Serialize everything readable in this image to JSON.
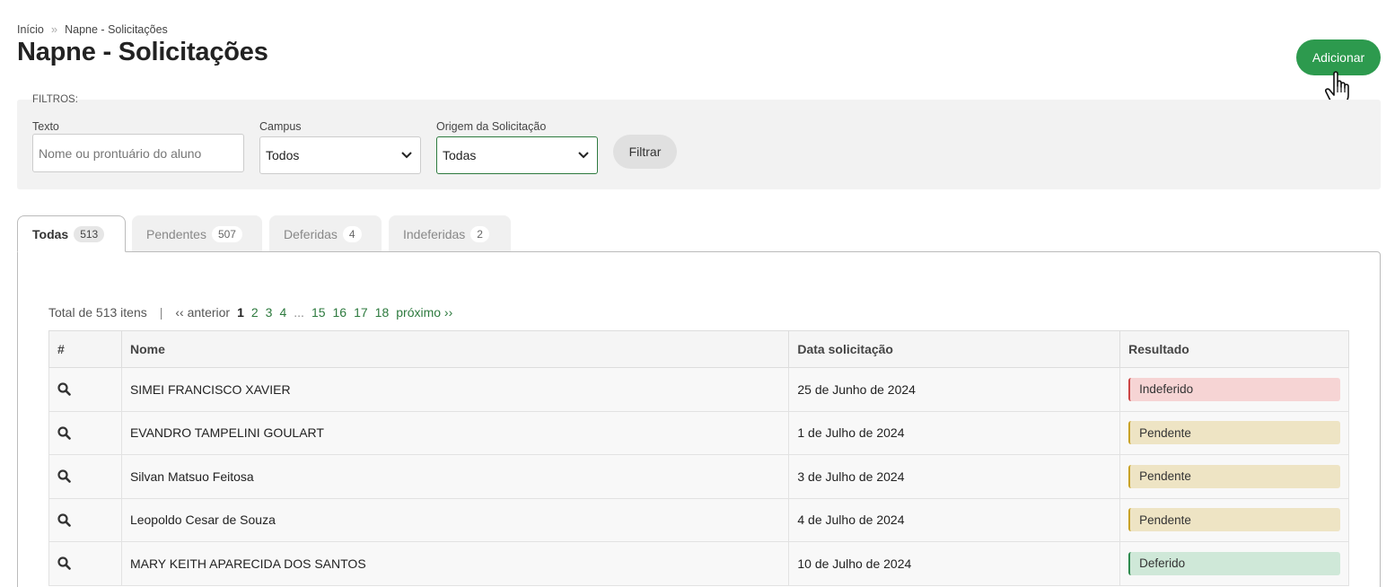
{
  "breadcrumb": {
    "home": "Início",
    "separator": "»",
    "current": "Napne - Solicitações"
  },
  "page_title": "Napne - Solicitações",
  "add_button": "Adicionar",
  "filters": {
    "title": "FILTROS:",
    "text_label": "Texto",
    "text_placeholder": "Nome ou prontuário do aluno",
    "campus_label": "Campus",
    "campus_value": "Todos",
    "origem_label": "Origem da Solicitação",
    "origem_value": "Todas",
    "filter_button": "Filtrar"
  },
  "tabs": [
    {
      "label": "Todas",
      "count": "513"
    },
    {
      "label": "Pendentes",
      "count": "507"
    },
    {
      "label": "Deferidas",
      "count": "4"
    },
    {
      "label": "Indeferidas",
      "count": "2"
    }
  ],
  "pagination": {
    "total": "Total de 513 itens",
    "divider": "|",
    "prev": "‹‹ anterior",
    "pages": [
      "1",
      "2",
      "3",
      "4",
      "...",
      "15",
      "16",
      "17",
      "18"
    ],
    "next": "próximo ››"
  },
  "table": {
    "headers": [
      "#",
      "Nome",
      "Data solicitação",
      "Resultado"
    ],
    "rows": [
      {
        "nome": "SIMEI FRANCISCO XAVIER",
        "data": "25 de Junho de 2024",
        "resultado": "Indeferido"
      },
      {
        "nome": "EVANDRO TAMPELINI GOULART",
        "data": "1 de Julho de 2024",
        "resultado": "Pendente"
      },
      {
        "nome": "Silvan Matsuo Feitosa",
        "data": "3 de Julho de 2024",
        "resultado": "Pendente"
      },
      {
        "nome": "Leopoldo Cesar de Souza",
        "data": "4 de Julho de 2024",
        "resultado": "Pendente"
      },
      {
        "nome": "MARY KEITH APARECIDA DOS SANTOS",
        "data": "10 de Julho de 2024",
        "resultado": "Deferido"
      }
    ]
  },
  "colors": {
    "primary_green": "#2d9a4e",
    "link_green": "#2d7a3e",
    "indeferido": "#f6d4d4",
    "pendente": "#eee4c4",
    "deferido": "#cfe8d8"
  }
}
